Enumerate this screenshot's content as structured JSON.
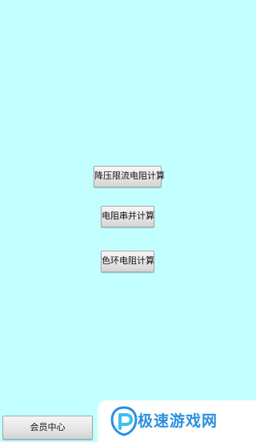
{
  "main": {
    "buttons": [
      {
        "label": "降压限流电阻计算"
      },
      {
        "label": "电阻串并计算"
      },
      {
        "label": "色环电阻计算"
      }
    ]
  },
  "bottom_bar": {
    "member_label": "会员中心"
  },
  "watermark": {
    "text": "极速游戏网"
  },
  "colors": {
    "background": "#c4ffff",
    "watermark_blue": "#2a8fe0"
  }
}
